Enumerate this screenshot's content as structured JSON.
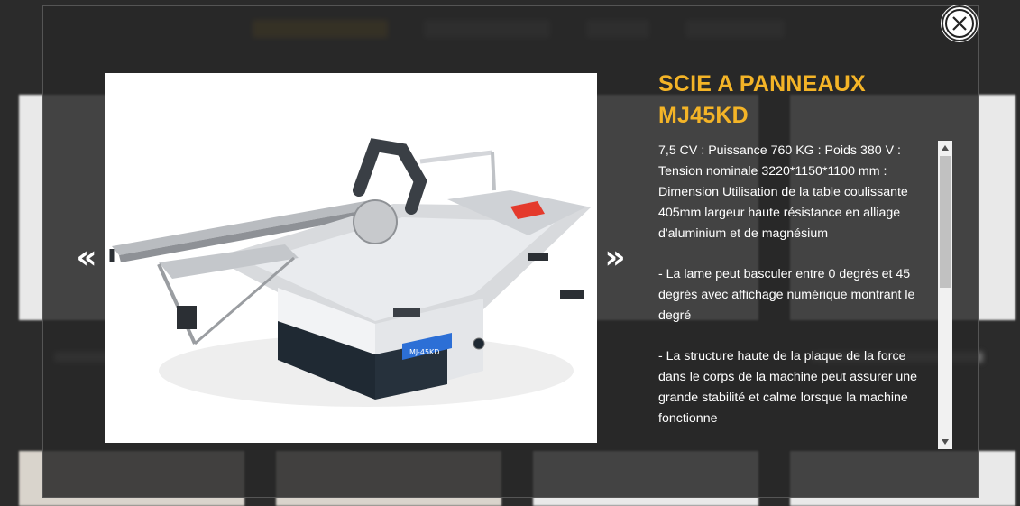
{
  "modal": {
    "title": "SCIE A PANNEAUX MJ45KD",
    "paragraphs": [
      "7,5 CV : Puissance 760 KG : Poids 380 V : Tension nominale 3220*1150*1100 mm : Dimension Utilisation de la table coulissante 405mm largeur haute résistance en alliage d'aluminium et de magnésium",
      "- La lame peut basculer entre 0 degrés et 45 degrés avec affichage numérique montrant le degré",
      "- La structure haute de la plaque de la force dans le corps de la machine peut assurer une grande stabilité et calme lorsque la machine fonctionne"
    ],
    "prev_arrow": "«",
    "next_arrow": "»",
    "close_icon": "close-circle-icon",
    "image_label": "MJ-45KD",
    "colors": {
      "title": "#f4b427",
      "overlay": "#282828",
      "panel_accent": "#e43a2c"
    }
  }
}
